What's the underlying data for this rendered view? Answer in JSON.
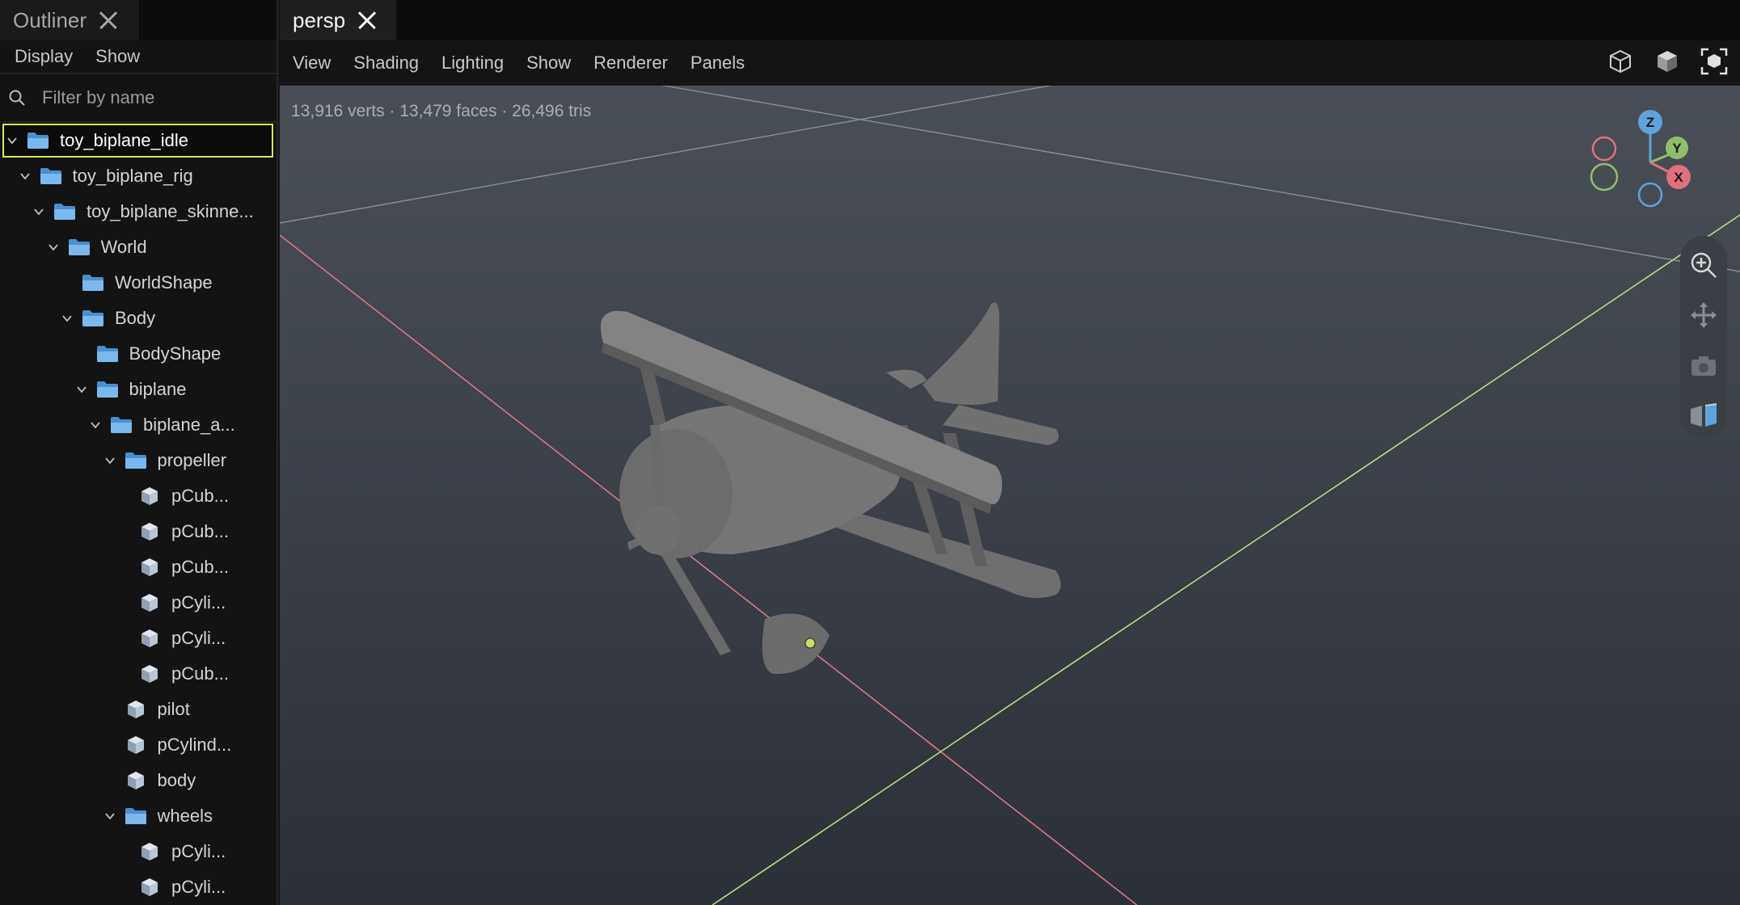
{
  "outliner": {
    "tab_label": "Outliner",
    "menu": [
      "Display",
      "Show"
    ],
    "search_placeholder": "Filter by name",
    "tree": [
      {
        "label": "toy_biplane_idle",
        "depth": 0,
        "expanded": true,
        "icon": "folder-icon",
        "selected": true
      },
      {
        "label": "toy_biplane_rig",
        "depth": 1,
        "expanded": true,
        "icon": "folder-icon"
      },
      {
        "label": "toy_biplane_skinne...",
        "depth": 2,
        "expanded": true,
        "icon": "folder-icon"
      },
      {
        "label": "World",
        "depth": 3,
        "expanded": true,
        "icon": "folder-icon"
      },
      {
        "label": "WorldShape",
        "depth": 4,
        "expanded": null,
        "icon": "folder-icon"
      },
      {
        "label": "Body",
        "depth": 4,
        "expanded": true,
        "icon": "folder-icon"
      },
      {
        "label": "BodyShape",
        "depth": 5,
        "expanded": null,
        "icon": "folder-icon"
      },
      {
        "label": "biplane",
        "depth": 5,
        "expanded": true,
        "icon": "folder-icon"
      },
      {
        "label": "biplane_a...",
        "depth": 6,
        "expanded": true,
        "icon": "folder-icon"
      },
      {
        "label": "propeller",
        "depth": 7,
        "expanded": true,
        "icon": "folder-icon"
      },
      {
        "label": "pCub...",
        "depth": 8,
        "expanded": null,
        "icon": "mesh-cube-icon"
      },
      {
        "label": "pCub...",
        "depth": 8,
        "expanded": null,
        "icon": "mesh-cube-icon"
      },
      {
        "label": "pCub...",
        "depth": 8,
        "expanded": null,
        "icon": "mesh-cube-icon"
      },
      {
        "label": "pCyli...",
        "depth": 8,
        "expanded": null,
        "icon": "mesh-cube-icon"
      },
      {
        "label": "pCyli...",
        "depth": 8,
        "expanded": null,
        "icon": "mesh-cube-icon"
      },
      {
        "label": "pCub...",
        "depth": 8,
        "expanded": null,
        "icon": "mesh-cube-icon"
      },
      {
        "label": "pilot",
        "depth": 7,
        "expanded": null,
        "icon": "mesh-cube-icon"
      },
      {
        "label": "pCylind...",
        "depth": 7,
        "expanded": null,
        "icon": "mesh-cube-icon"
      },
      {
        "label": "body",
        "depth": 7,
        "expanded": null,
        "icon": "mesh-cube-icon"
      },
      {
        "label": "wheels",
        "depth": 7,
        "expanded": true,
        "icon": "folder-icon"
      },
      {
        "label": "pCyli...",
        "depth": 8,
        "expanded": null,
        "icon": "mesh-cube-icon"
      },
      {
        "label": "pCyli...",
        "depth": 8,
        "expanded": null,
        "icon": "mesh-cube-icon"
      }
    ]
  },
  "viewport": {
    "tab_label": "persp",
    "menu": [
      "View",
      "Shading",
      "Lighting",
      "Show",
      "Renderer",
      "Panels"
    ],
    "stats": "13,916 verts · 13,479 faces · 26,496 tris",
    "tools": [
      "wireframe-cube-icon",
      "shaded-cube-icon",
      "frame-selection-icon"
    ],
    "gizmo": {
      "labels": {
        "z": "Z",
        "y": "Y",
        "x": "X"
      },
      "colors": {
        "x": "#e0707d",
        "y": "#8fbf6a",
        "z": "#5fa3dc"
      }
    },
    "nav_tools": [
      "zoom-icon",
      "pan-icon",
      "camera-icon",
      "view-cube-icon"
    ]
  },
  "colors": {
    "selection": "#d9ef52",
    "grid_x_axis": "#d9787f",
    "grid_z_axis": "#b9dc7a",
    "model": "#7c7c7c"
  }
}
